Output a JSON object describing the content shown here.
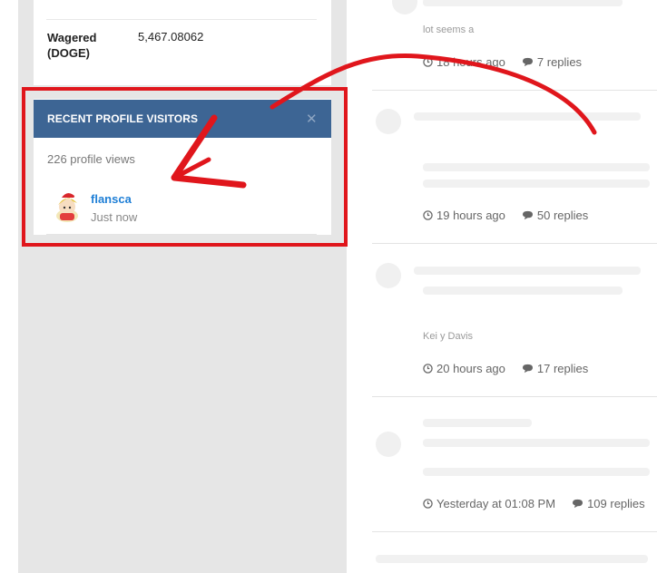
{
  "stats": {
    "wagered_label": "Wagered (DOGE)",
    "wagered_value": "5,467.08062"
  },
  "visitors_widget": {
    "title": "RECENT PROFILE VISITORS",
    "profile_views": "226 profile views",
    "visitors": [
      {
        "name": "flansca",
        "time": "Just now"
      }
    ]
  },
  "topics": [
    {
      "time": "18 hours ago",
      "replies": "7 replies"
    },
    {
      "time": "19 hours ago",
      "replies": "50 replies"
    },
    {
      "time": "20 hours ago",
      "replies": "17 replies"
    },
    {
      "time": "Yesterday at 01:08 PM",
      "replies": "109 replies"
    }
  ],
  "faint": {
    "topic1_line": "lot seems a",
    "topic3_author": "Kei y Davis"
  },
  "colors": {
    "header_blue": "#3d6594",
    "highlight_red": "#e0161c",
    "link_blue": "#1f7fd6"
  },
  "icons": {
    "clock": "clock-icon",
    "comment": "comment-icon",
    "close": "close-icon"
  }
}
